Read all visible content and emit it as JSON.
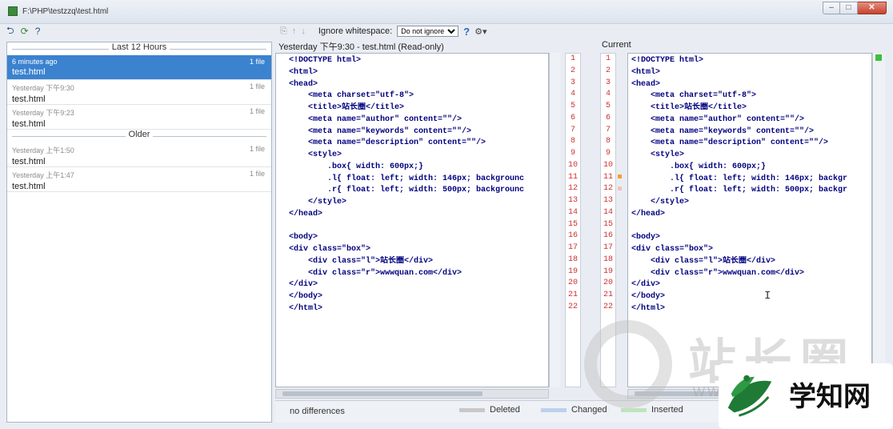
{
  "window": {
    "title": "F:\\PHP\\testzzq\\test.html"
  },
  "left_toolbar": {
    "icons": [
      "revert-icon",
      "refresh-icon",
      "help-icon"
    ],
    "help_label": "?"
  },
  "history": {
    "group1_label": "Last 12 Hours",
    "group2_label": "Older",
    "items": [
      {
        "time": "6 minutes ago",
        "name": "test.html",
        "count": "1 file",
        "selected": true
      },
      {
        "time": "Yesterday 下午9:30",
        "name": "test.html",
        "count": "1 file",
        "selected": false
      },
      {
        "time": "Yesterday 下午9:23",
        "name": "test.html",
        "count": "1 file",
        "selected": false
      },
      {
        "time": "Yesterday 上午1:50",
        "name": "test.html",
        "count": "1 file",
        "selected": false
      },
      {
        "time": "Yesterday 上午1:47",
        "name": "test.html",
        "count": "1 file",
        "selected": false
      }
    ]
  },
  "diff_toolbar": {
    "ignore_label": "Ignore whitespace:",
    "select_value": "Do not ignore",
    "help_label": "?",
    "settings_icon": "gear-icon"
  },
  "left_pane_title": "Yesterday 下午9:30 - test.html (Read-only)",
  "right_pane_title": "Current",
  "line_numbers": [
    "1",
    "2",
    "3",
    "4",
    "5",
    "6",
    "7",
    "8",
    "9",
    "10",
    "11",
    "12",
    "13",
    "14",
    "15",
    "16",
    "17",
    "18",
    "19",
    "20",
    "21",
    "22"
  ],
  "left_code": [
    "<!DOCTYPE html>",
    "<html>",
    "<head>",
    "    <meta charset=\"utf-8\">",
    "    <title>站长圈</title>",
    "    <meta name=\"author\" content=\"\"/>",
    "    <meta name=\"keywords\" content=\"\"/>",
    "    <meta name=\"description\" content=\"\"/>",
    "    <style>",
    "        .box{ width: 600px;}",
    "        .l{ float: left; width: 146px; backgrounc",
    "        .r{ float: left; width: 500px; backgrounc",
    "    </style>",
    "</head>",
    "",
    "<body>",
    "<div class=\"box\">",
    "    <div class=\"l\">站长圈</div>",
    "    <div class=\"r\">wwwquan.com</div>",
    "</div>",
    "</body>",
    "</html>"
  ],
  "right_code": [
    "<!DOCTYPE html>",
    "<html>",
    "<head>",
    "    <meta charset=\"utf-8\">",
    "    <title>站长圈</title>",
    "    <meta name=\"author\" content=\"\"/>",
    "    <meta name=\"keywords\" content=\"\"/>",
    "    <meta name=\"description\" content=\"\"/>",
    "    <style>",
    "        .box{ width: 600px;}",
    "        .l{ float: left; width: 146px; backgr",
    "        .r{ float: left; width: 500px; backgr",
    "    </style>",
    "</head>",
    "",
    "<body>",
    "<div class=\"box\">",
    "    <div class=\"l\">站长圈</div>",
    "    <div class=\"r\">wwwquan.com</div>",
    "</div>",
    "</body>",
    "</html>"
  ],
  "status": {
    "text": "no differences",
    "legend": [
      {
        "label": "Deleted",
        "color": "#c8c8c8"
      },
      {
        "label": "Changed",
        "color": "#bcd0ee"
      },
      {
        "label": "Inserted",
        "color": "#bfe3bf"
      }
    ]
  },
  "colors": {
    "selection": "#3b82cf",
    "line_number": "#cc3333",
    "tag": "#00007f",
    "string": "#008000"
  },
  "watermark": {
    "text": "站长圈",
    "sub": "WWW"
  },
  "brand": {
    "text": "学知网"
  }
}
